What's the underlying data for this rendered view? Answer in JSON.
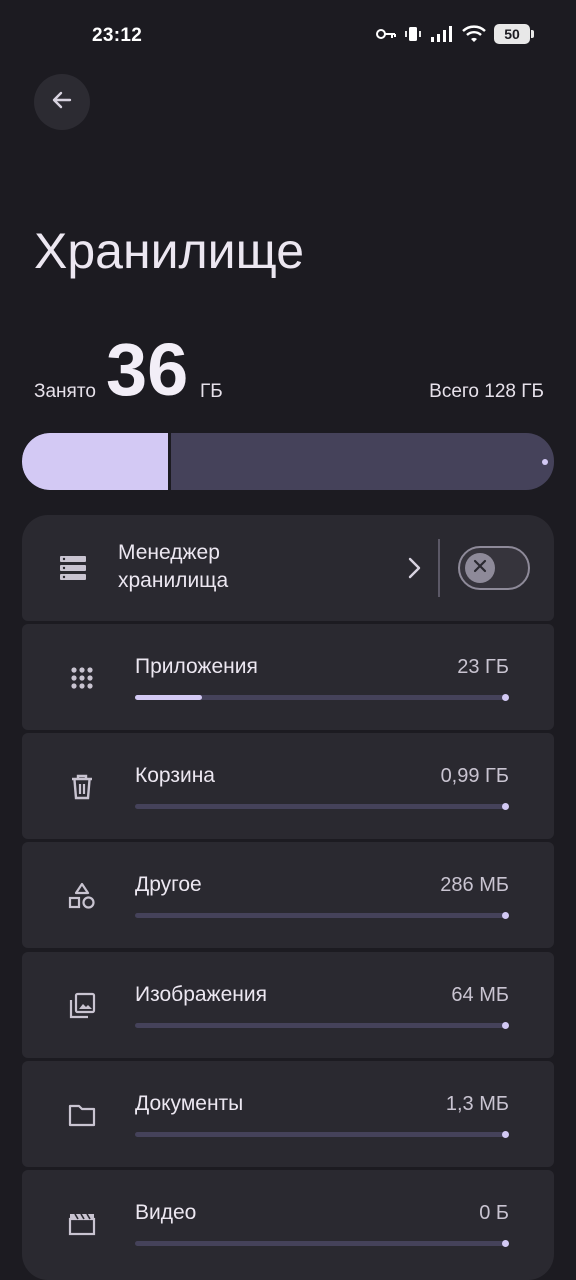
{
  "status_bar": {
    "time": "23:12",
    "battery": "50",
    "icons": [
      "key-icon",
      "vibrate-icon",
      "signal-icon",
      "wifi-icon",
      "battery-icon"
    ]
  },
  "header": {
    "back_icon": "arrow-left-icon",
    "title": "Хранилище"
  },
  "usage": {
    "used_label": "Занято",
    "used_value": "36",
    "used_unit": "ГБ",
    "total_label": "Всего 128 ГБ",
    "used_fraction": 0.28
  },
  "manager": {
    "icon": "storage-icon",
    "label": "Менеджер хранилища",
    "chevron_icon": "chevron-right-icon",
    "toggle_on": false
  },
  "categories": [
    {
      "icon": "apps-grid-icon",
      "label": "Приложения",
      "size": "23 ГБ",
      "fraction": 0.18
    },
    {
      "icon": "trash-icon",
      "label": "Корзина",
      "size": "0,99 ГБ",
      "fraction": 0.0
    },
    {
      "icon": "shapes-icon",
      "label": "Другое",
      "size": "286 МБ",
      "fraction": 0.0
    },
    {
      "icon": "images-icon",
      "label": "Изображения",
      "size": "64 МБ",
      "fraction": 0.0
    },
    {
      "icon": "folder-icon",
      "label": "Документы",
      "size": "1,3 МБ",
      "fraction": 0.0
    },
    {
      "icon": "video-icon",
      "label": "Видео",
      "size": "0 Б",
      "fraction": 0.0
    }
  ],
  "colors": {
    "background": "#1c1b21",
    "card": "#2a2930",
    "accent": "#d3c9f4",
    "track": "#45425a"
  }
}
